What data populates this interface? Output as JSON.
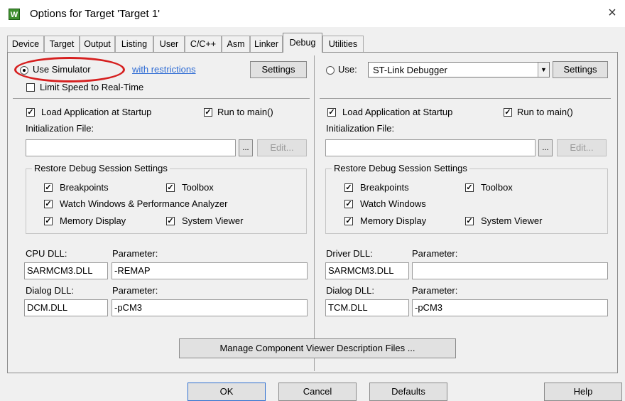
{
  "window": {
    "title": "Options for Target 'Target 1'",
    "close": "×",
    "app_icon": "W"
  },
  "tabs": [
    "Device",
    "Target",
    "Output",
    "Listing",
    "User",
    "C/C++",
    "Asm",
    "Linker",
    "Debug",
    "Utilities"
  ],
  "active_tab": "Debug",
  "left": {
    "use_simulator": "Use Simulator",
    "with_restrictions": "with restrictions",
    "settings": "Settings",
    "limit_speed": "Limit Speed to Real-Time",
    "load_app": "Load Application at Startup",
    "run_to_main": "Run to main()",
    "init_file_label": "Initialization File:",
    "init_file_value": "",
    "browse": "...",
    "edit": "Edit...",
    "restore_title": "Restore Debug Session Settings",
    "breakpoints": "Breakpoints",
    "toolbox": "Toolbox",
    "watch_windows": "Watch Windows & Performance Analyzer",
    "memory_display": "Memory Display",
    "system_viewer": "System Viewer",
    "cpu_dll_label": "CPU DLL:",
    "parameter_label": "Parameter:",
    "cpu_dll": "SARMCM3.DLL",
    "cpu_param": "-REMAP",
    "dialog_dll_label": "Dialog DLL:",
    "dialog_dll": "DCM.DLL",
    "dialog_param": "-pCM3"
  },
  "right": {
    "use": "Use:",
    "debugger": "ST-Link Debugger",
    "settings": "Settings",
    "load_app": "Load Application at Startup",
    "run_to_main": "Run to main()",
    "init_file_label": "Initialization File:",
    "init_file_value": "",
    "browse": "...",
    "edit": "Edit...",
    "restore_title": "Restore Debug Session Settings",
    "breakpoints": "Breakpoints",
    "toolbox": "Toolbox",
    "watch_windows": "Watch Windows",
    "memory_display": "Memory Display",
    "system_viewer": "System Viewer",
    "driver_dll_label": "Driver DLL:",
    "parameter_label": "Parameter:",
    "driver_dll": "SARMCM3.DLL",
    "driver_param": "",
    "dialog_dll_label": "Dialog DLL:",
    "dialog_dll": "TCM.DLL",
    "dialog_param": "-pCM3"
  },
  "manage_button": "Manage Component Viewer Description Files ...",
  "footer": {
    "ok": "OK",
    "cancel": "Cancel",
    "defaults": "Defaults",
    "help": "Help"
  },
  "checkmark": "✓",
  "colors": {
    "highlight_oval": "#d62020",
    "link": "#2d6bd4"
  }
}
